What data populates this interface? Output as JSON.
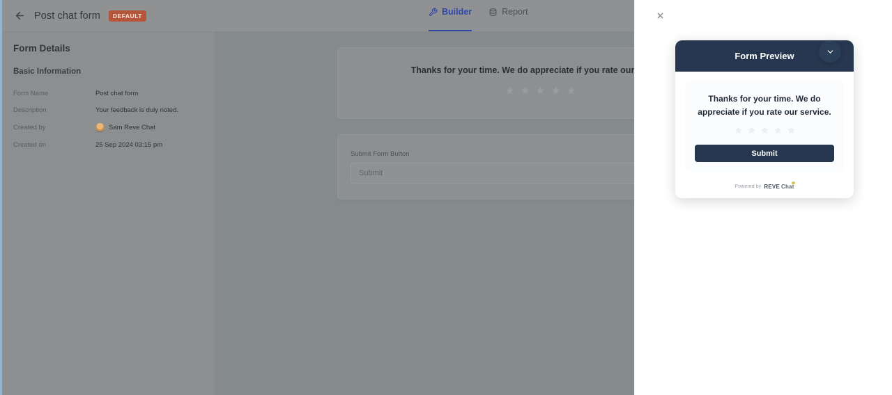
{
  "header": {
    "back_icon": "arrow-left-icon",
    "title": "Post chat form",
    "badge": "DEFAULT",
    "tabs": [
      {
        "label": "Builder",
        "icon": "wrench-icon",
        "active": true
      },
      {
        "label": "Report",
        "icon": "database-icon",
        "active": false
      }
    ],
    "accent_color": "#2f48a8",
    "badge_color": "#b5563a"
  },
  "sidebar": {
    "title": "Form Details",
    "section_title": "Basic Information",
    "rows": [
      {
        "label": "Form Name",
        "value": "Post chat form"
      },
      {
        "label": "Description",
        "value": "Your feedback is duly noted."
      },
      {
        "label": "Created by",
        "value": "Sam Reve Chat",
        "icon": "avatar"
      },
      {
        "label": "Created on",
        "value": "25 Sep 2024 03:15 pm"
      }
    ]
  },
  "canvas": {
    "message_card": {
      "text": "Thanks for your time. We do appreciate if you rate our service.",
      "star_count": 5
    },
    "submit_card": {
      "field_label": "Submit Form Button",
      "input_value": "",
      "input_placeholder": "Submit"
    }
  },
  "preview": {
    "close_icon": "close-icon",
    "header_title": "Form Preview",
    "message": "Thanks for your time. We do appreciate if you rate our service.",
    "star_count": 5,
    "submit_label": "Submit",
    "powered_by": "Powered by",
    "brand_first": "REVE",
    "brand_second": "Chat",
    "fab_icon": "chevron-down-icon",
    "header_color": "#26374f",
    "submit_color": "#26374f"
  }
}
